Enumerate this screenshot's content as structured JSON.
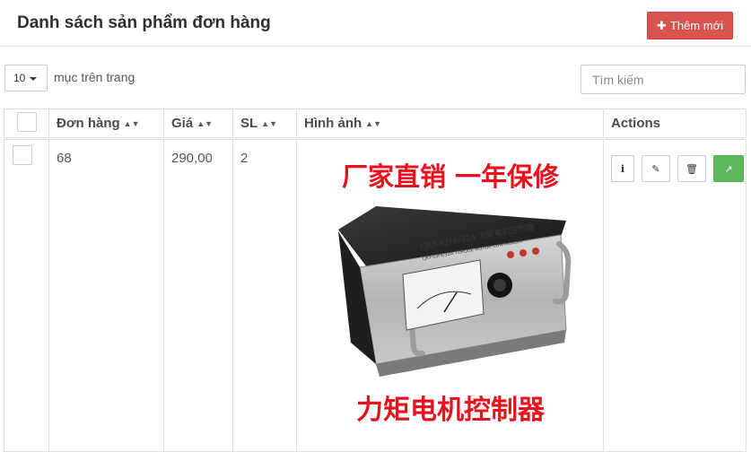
{
  "header": {
    "title": "Danh sách sản phẩm đơn hàng",
    "add_label": "Thêm mới",
    "add_color": "#d9534f"
  },
  "controls": {
    "page_length": "10",
    "page_length_label": "mục trên trang",
    "search_placeholder": "Tìm kiếm"
  },
  "table": {
    "columns": [
      "Đơn hàng",
      "Giá",
      "SL",
      "Hình ảnh",
      "Actions"
    ],
    "rows": [
      {
        "order": "68",
        "price": "290,00",
        "quantity": "2",
        "image": {
          "top_text": "厂家直销  一年保修",
          "bottom_text": "力矩电机控制器",
          "panel_label": "LJKY-II3FK-32A 力矩电机控制器",
          "panel_sublabel": "LJKY-II3FK-32A TORQUE MOTOR CONTROLLER"
        }
      }
    ],
    "action_icons": [
      "info-icon",
      "edit-icon",
      "trash-icon",
      "external-link-icon"
    ],
    "accent_green": "#5cb85c"
  }
}
